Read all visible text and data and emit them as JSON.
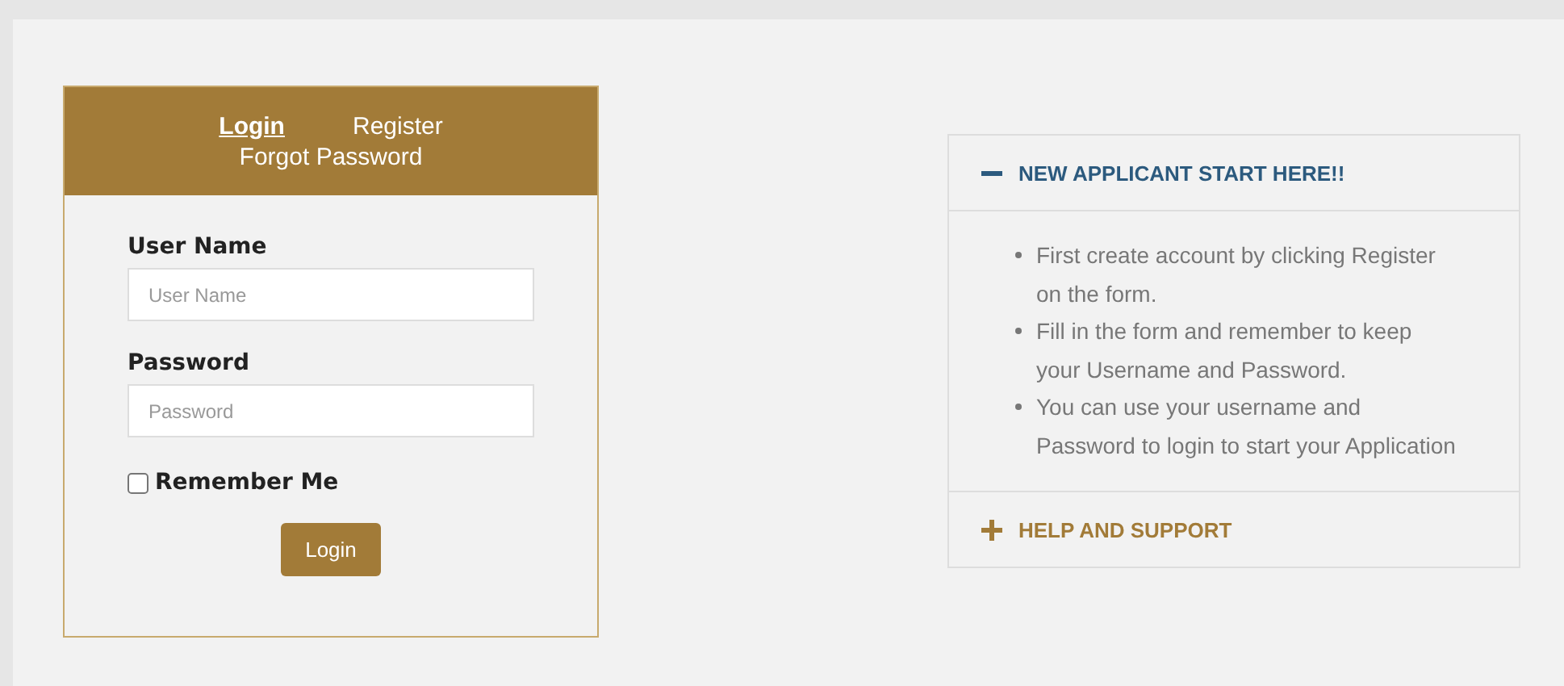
{
  "login_card": {
    "tabs": [
      {
        "label": "Login",
        "selected": true
      },
      {
        "label": "Register",
        "selected": false
      },
      {
        "label": "Forgot Password",
        "selected": false
      }
    ],
    "fields": [
      {
        "label": "User Name",
        "placeholder": "User Name"
      },
      {
        "label": "Password",
        "placeholder": "Password"
      }
    ],
    "remember": {
      "label": "Remember Me",
      "checked": false
    },
    "button": "Login"
  },
  "accordion": [
    {
      "title": "NEW APPLICANT START HERE!!",
      "expanded": true,
      "items": [
        "First create account by clicking Register on the form.",
        "Fill in the form and remember to keep your Username and Password.",
        "You can use your username and Password to login to start your Application"
      ]
    },
    {
      "title": "HELP AND SUPPORT",
      "expanded": false
    }
  ]
}
